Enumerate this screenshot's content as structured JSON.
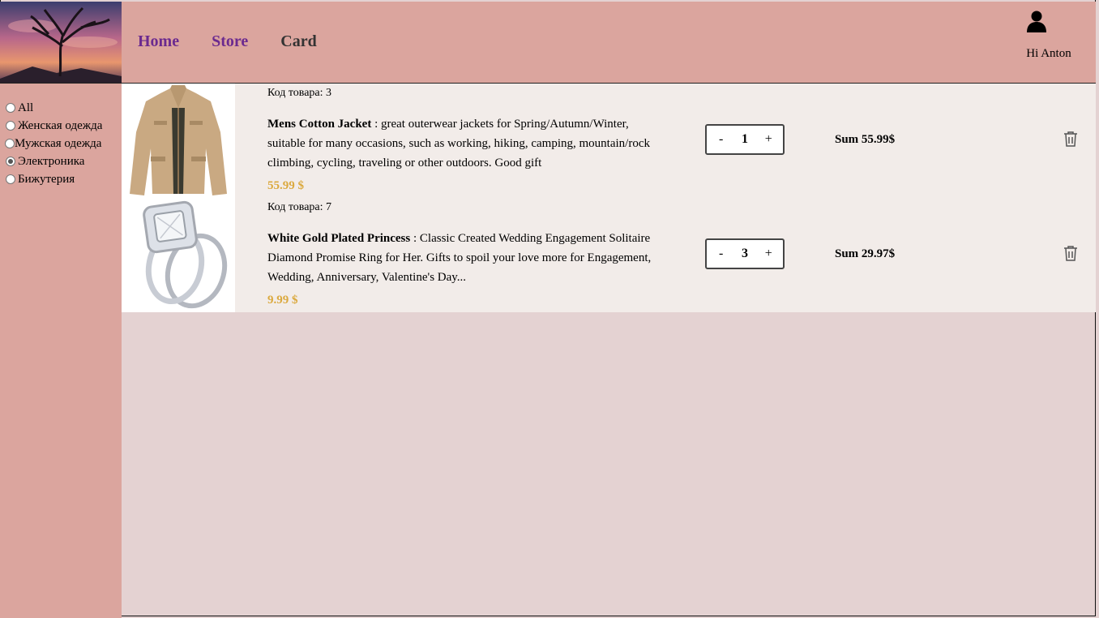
{
  "nav": {
    "home": "Home",
    "store": "Store",
    "card": "Card"
  },
  "user": {
    "greeting": "Hi Anton",
    "icon": "user-icon"
  },
  "filters": [
    {
      "label": "All",
      "checked": false
    },
    {
      "label": "Женская одежда",
      "checked": false
    },
    {
      "label": "Мужская одежда",
      "checked": false
    },
    {
      "label": "Электроника",
      "checked": true
    },
    {
      "label": "Бижутерия",
      "checked": false
    }
  ],
  "items": [
    {
      "code": "Код товара: 3",
      "title": "Mens Cotton Jacket",
      "description": " : great outerwear jackets for Spring/Autumn/Winter, suitable for many occasions, such as working, hiking, camping, mountain/rock climbing, cycling, traveling or other outdoors. Good gift",
      "price": "55.99 $",
      "qty_minus": "-",
      "quantity": "1",
      "qty_plus": "+",
      "sum": "Sum 55.99$"
    },
    {
      "code": "Код товара: 7",
      "title": "White Gold Plated Princess",
      "description": " : Classic Created Wedding Engagement Solitaire Diamond Promise Ring for Her. Gifts to spoil your love more for Engagement, Wedding, Anniversary, Valentine's Day...",
      "price": "9.99 $",
      "qty_minus": "-",
      "quantity": "3",
      "qty_plus": "+",
      "sum": "Sum 29.97$"
    }
  ],
  "colors": {
    "header_bg": "#dba59e",
    "content_bg": "#f2ece9",
    "page_bg": "#e4d2d2",
    "price": "#dba93e",
    "nav_link": "#6b2a8f",
    "nav_active": "#333333"
  }
}
